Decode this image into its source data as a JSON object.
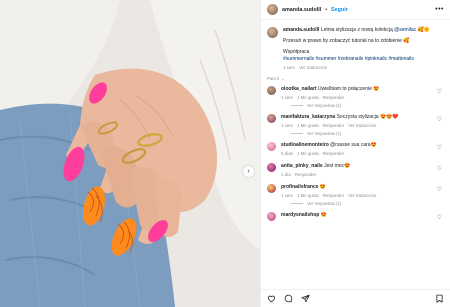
{
  "post": {
    "author": "amanda.sudolll",
    "separator": "•",
    "follow_label": "Seguir",
    "more_label": "•••",
    "caption": {
      "username": "amanda.sudolll",
      "line1": "Letnia stylizacja z nową kolekcją",
      "mention": "@semilac",
      "emoji1": "🥰🌞",
      "line2": "Przesuń w prawo by zobaczyć tutorial na to zdobienie",
      "emoji2": "🥰",
      "line3": "Współpraca",
      "hashtags": "#summernails #summer #zebranails #pinknails #mattenails",
      "time": "1 sem",
      "translate": "Ver traducción"
    },
    "para_ti": "Para ti",
    "next_icon": "chevron-right-icon"
  },
  "comments": [
    {
      "username": "olootka_nailart",
      "text": "Uwielbiam to połączenie 😍",
      "time": "1 sem",
      "likes": "1 Me gusta",
      "reply": "Responder",
      "translate": "",
      "replies": "Ver respuestas (1)"
    },
    {
      "username": "manifaktura_katarzyna",
      "text": "Soczysta stylizacja 😍😍❤️",
      "time": "1 sem",
      "likes": "1 Me gusta",
      "reply": "Responder",
      "translate": "Ver traducción",
      "replies": "Ver respuestas (1)"
    },
    {
      "username": "studioalinemonteiro",
      "text": "@rsasse sua cara😍",
      "time": "5 días",
      "likes": "1 Me gusta",
      "reply": "Responder",
      "translate": "",
      "replies": ""
    },
    {
      "username": "anita_pinky_nails",
      "text": "Jest moc😍",
      "time": "1 día",
      "likes": "",
      "reply": "Responder",
      "translate": "",
      "replies": ""
    },
    {
      "username": "profinailsfrance",
      "text": "😍",
      "time": "1 sem",
      "likes": "1 Me gusta",
      "reply": "Responder",
      "translate": "Ver traducción",
      "replies": "Ver respuestas (1)"
    },
    {
      "username": "mardysnailshop",
      "text": "😍",
      "time": "",
      "likes": "",
      "reply": "",
      "translate": "",
      "replies": ""
    }
  ],
  "colors": {
    "follow": "#0095f6",
    "link": "#00376b",
    "muted": "#8e8e8e",
    "nail_pink": "#ff3d9a",
    "nail_orange": "#ff8a1e"
  }
}
